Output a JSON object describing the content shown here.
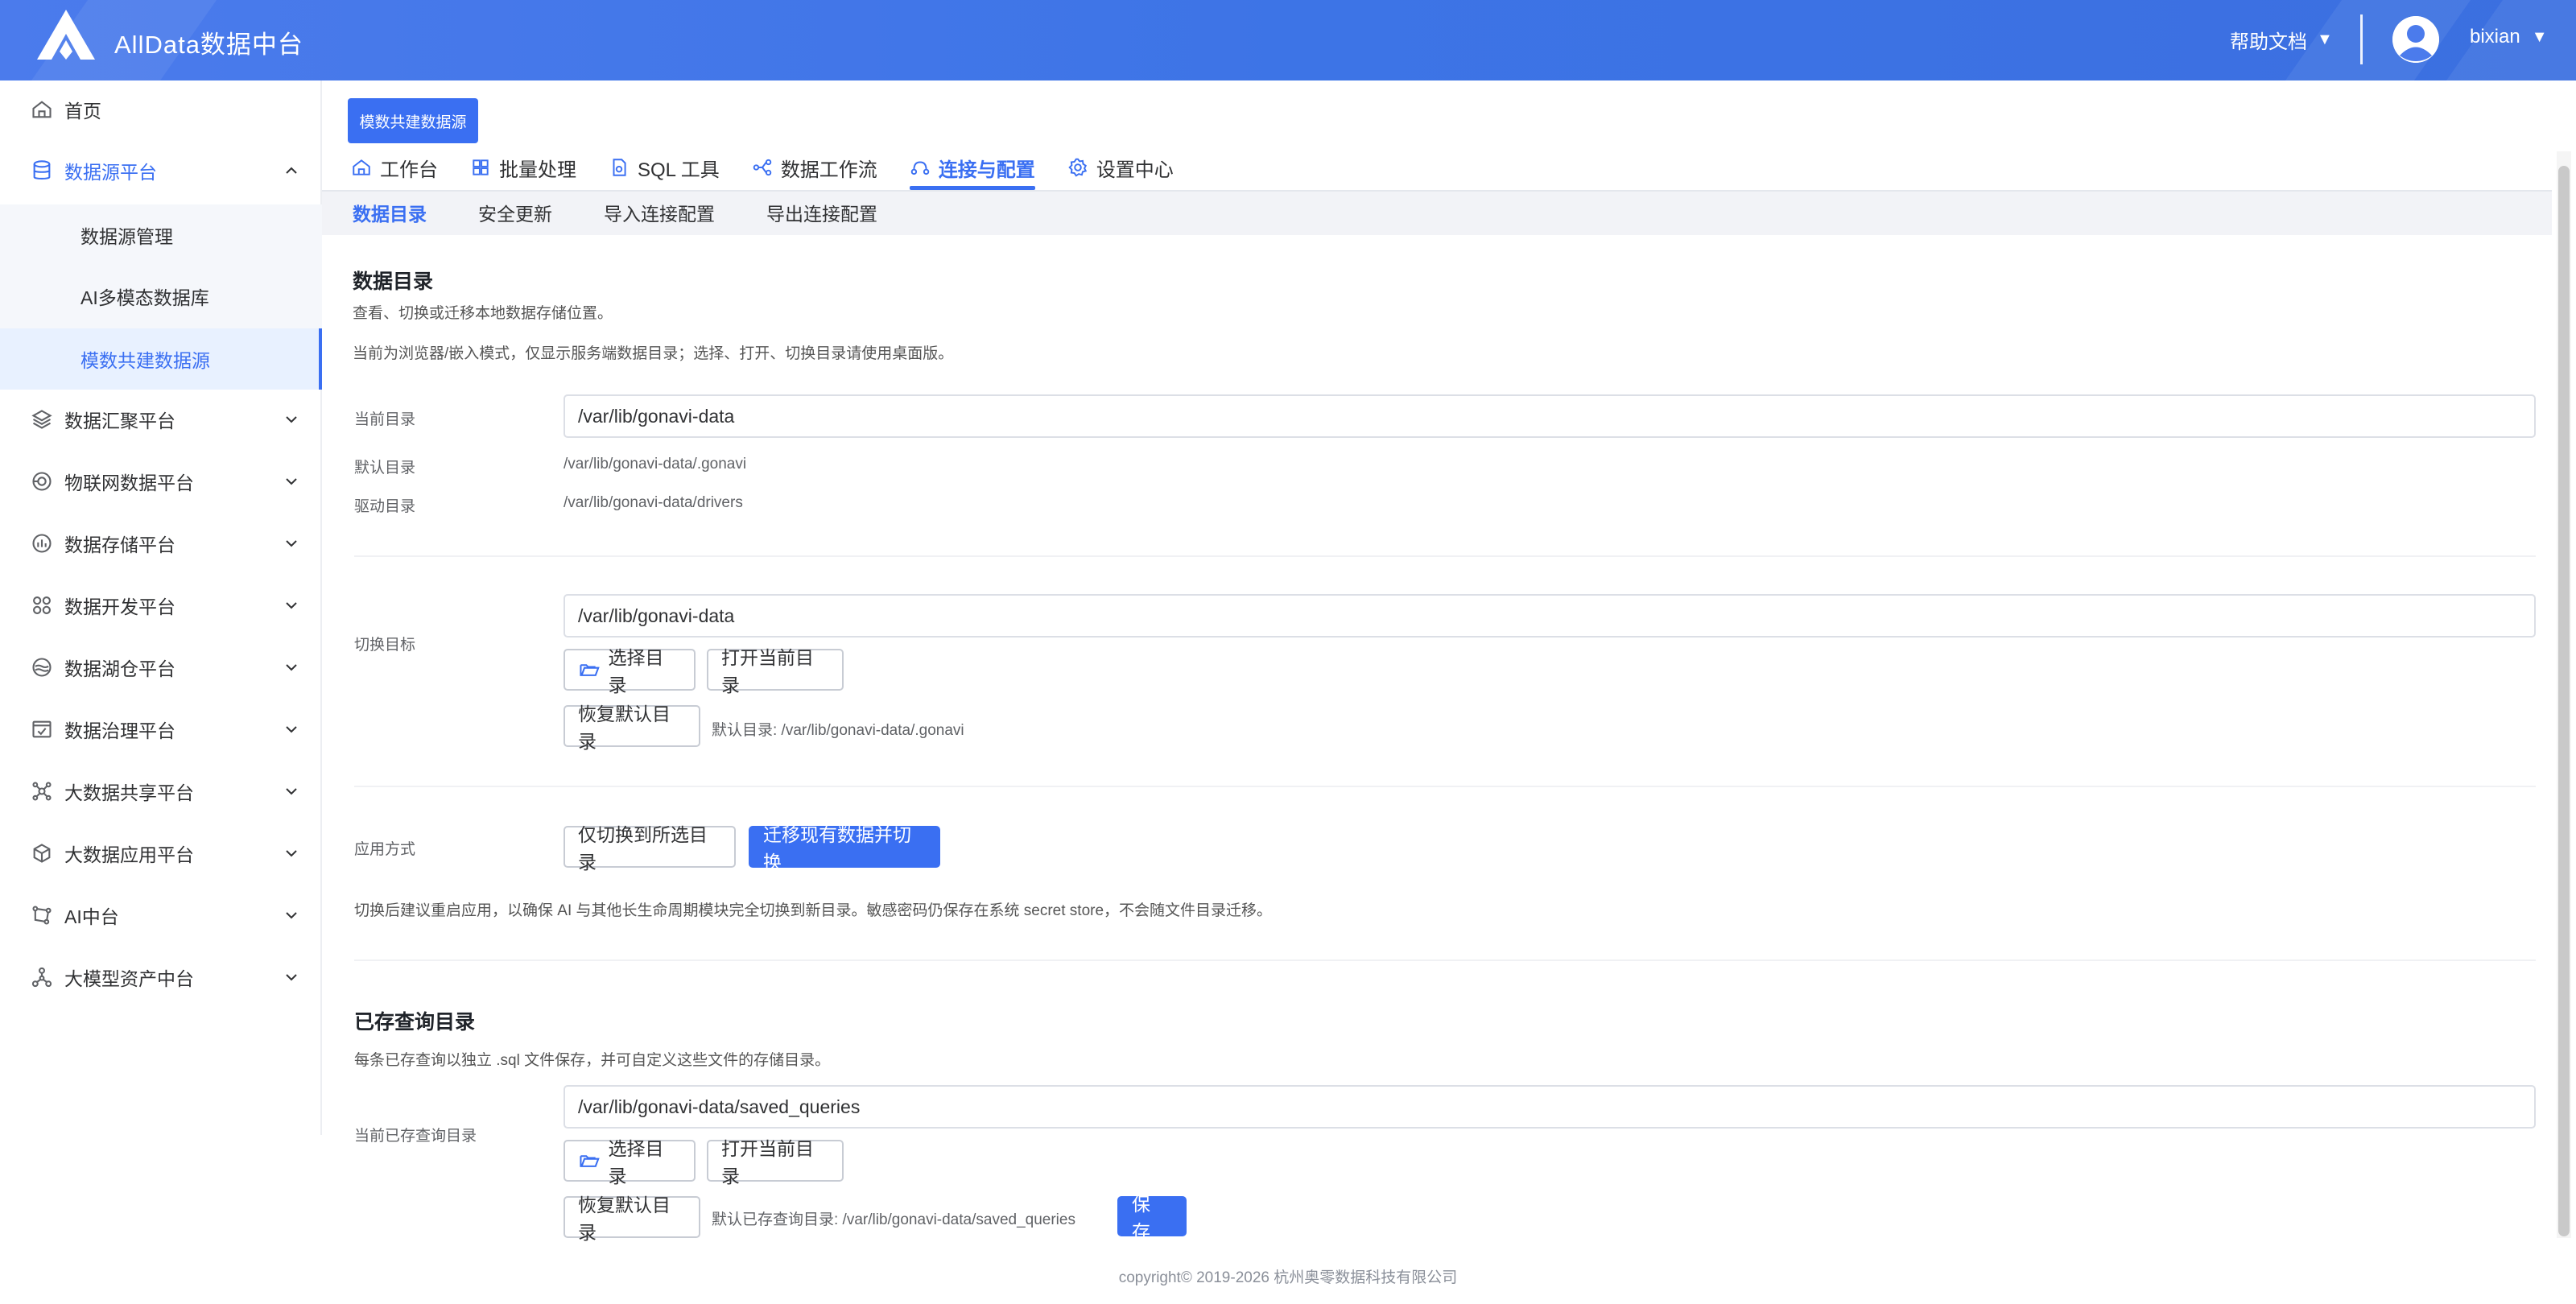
{
  "header": {
    "app_title": "AllData数据中台",
    "help_label": "帮助文档",
    "username": "bixian"
  },
  "sidebar": {
    "items": [
      {
        "label": "首页",
        "icon": "home-icon"
      },
      {
        "label": "数据源平台",
        "icon": "database-icon",
        "expanded": true
      },
      {
        "label": "数据汇聚平台",
        "icon": "layers-icon"
      },
      {
        "label": "物联网数据平台",
        "icon": "iot-icon"
      },
      {
        "label": "数据存储平台",
        "icon": "storage-icon"
      },
      {
        "label": "数据开发平台",
        "icon": "dev-icon"
      },
      {
        "label": "数据湖仓平台",
        "icon": "lake-icon"
      },
      {
        "label": "数据治理平台",
        "icon": "governance-icon"
      },
      {
        "label": "大数据共享平台",
        "icon": "share-icon"
      },
      {
        "label": "大数据应用平台",
        "icon": "app-icon"
      },
      {
        "label": "AI中台",
        "icon": "ai-icon"
      },
      {
        "label": "大模型资产中台",
        "icon": "model-icon"
      }
    ],
    "subitems": [
      {
        "label": "数据源管理"
      },
      {
        "label": "AI多模态数据库"
      },
      {
        "label": "模数共建数据源",
        "active": true
      }
    ]
  },
  "main": {
    "page_tag": "模数共建数据源",
    "tabs": [
      {
        "label": "工作台",
        "icon": "home-icon"
      },
      {
        "label": "批量处理",
        "icon": "grid-icon"
      },
      {
        "label": "SQL 工具",
        "icon": "file-icon"
      },
      {
        "label": "数据工作流",
        "icon": "workflow-icon"
      },
      {
        "label": "连接与配置",
        "icon": "connection-icon",
        "active": true
      },
      {
        "label": "设置中心",
        "icon": "gear-icon"
      }
    ],
    "subtabs": [
      {
        "label": "数据目录",
        "active": true
      },
      {
        "label": "安全更新"
      },
      {
        "label": "导入连接配置"
      },
      {
        "label": "导出连接配置"
      }
    ],
    "data_dir": {
      "title": "数据目录",
      "desc1": "查看、切换或迁移本地数据存储位置。",
      "desc2": "当前为浏览器/嵌入模式，仅显示服务端数据目录；选择、打开、切换目录请使用桌面版。",
      "current_label": "当前目录",
      "current_value": "/var/lib/gonavi-data",
      "default_label": "默认目录",
      "default_value": "/var/lib/gonavi-data/.gonavi",
      "driver_label": "驱动目录",
      "driver_value": "/var/lib/gonavi-data/drivers",
      "switch_label": "切换目标",
      "switch_value": "/var/lib/gonavi-data",
      "choose_btn": "选择目录",
      "open_btn": "打开当前目录",
      "restore_btn": "恢复默认目录",
      "restore_hint": "默认目录: /var/lib/gonavi-data/.gonavi",
      "apply_label": "应用方式",
      "only_switch_btn": "仅切换到所选目录",
      "migrate_btn": "迁移现有数据并切换",
      "apply_note": "切换后建议重启应用，以确保 AI 与其他长生命周期模块完全切换到新目录。敏感密码仍保存在系统 secret store，不会随文件目录迁移。"
    },
    "saved_queries": {
      "title": "已存查询目录",
      "desc": "每条已存查询以独立 .sql 文件保存，并可自定义这些文件的存储目录。",
      "current_label": "当前已存查询目录",
      "current_value": "/var/lib/gonavi-data/saved_queries",
      "choose_btn": "选择目录",
      "open_btn": "打开当前目录",
      "restore_btn": "恢复默认目录",
      "restore_hint": "默认已存查询目录: /var/lib/gonavi-data/saved_queries",
      "save_btn": "保 存"
    }
  },
  "footer": {
    "copyright": "copyright© 2019-2026 杭州奥零数据科技有限公司"
  },
  "colors": {
    "primary": "#3a6ff2",
    "header_bg": "#3d74e6",
    "sidebar_active_bg": "#e8f1ff"
  }
}
